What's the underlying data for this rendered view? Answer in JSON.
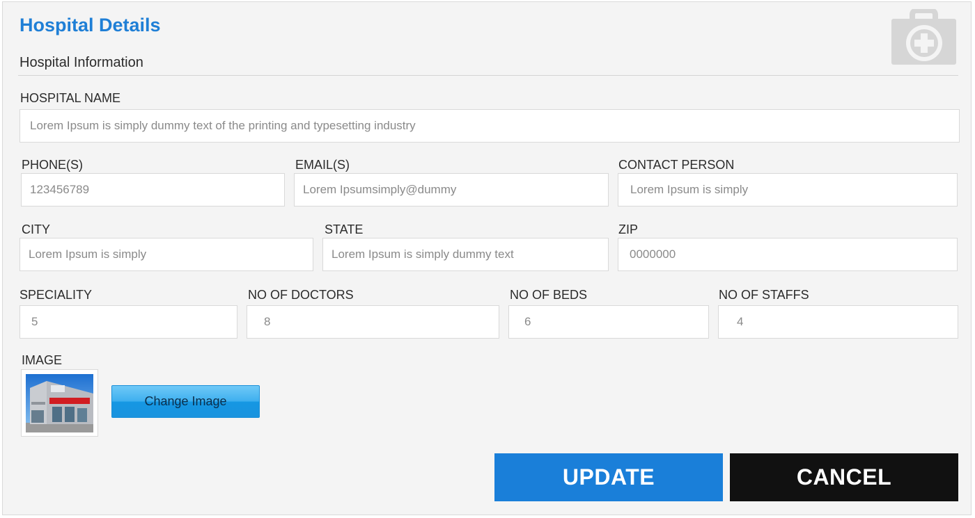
{
  "header": {
    "title": "Hospital Details",
    "subtitle": "Hospital Information",
    "icon": "medical-kit-icon"
  },
  "form": {
    "hospital_name": {
      "label": "HOSPITAL NAME",
      "value": "Lorem Ipsum is simply dummy text of the printing and typesetting industry"
    },
    "phones": {
      "label": "PHONE(S)",
      "value": "123456789"
    },
    "emails": {
      "label": "EMAIL(S)",
      "value": "Lorem Ipsumsimply@dummy"
    },
    "contact_person": {
      "label": "CONTACT PERSON",
      "value": "Lorem Ipsum is simply"
    },
    "city": {
      "label": "CITY",
      "value": "Lorem Ipsum is simply"
    },
    "state": {
      "label": "STATE",
      "value": "Lorem Ipsum is simply dummy text"
    },
    "zip": {
      "label": "ZIP",
      "value": "0000000"
    },
    "speciality": {
      "label": "SPECIALITY",
      "value": "5"
    },
    "no_of_doctors": {
      "label": "NO OF DOCTORS",
      "value": "8"
    },
    "no_of_beds": {
      "label": "NO OF BEDS",
      "value": "6"
    },
    "no_of_staffs": {
      "label": "NO OF STAFFS",
      "value": "4"
    },
    "image": {
      "label": "IMAGE",
      "change_label": "Change Image"
    }
  },
  "actions": {
    "update_label": "UPDATE",
    "cancel_label": "CANCEL"
  },
  "colors": {
    "accent": "#1f7fd6",
    "update_bg": "#1a7fd9",
    "cancel_bg": "#111111",
    "panel_bg": "#f4f4f4"
  }
}
